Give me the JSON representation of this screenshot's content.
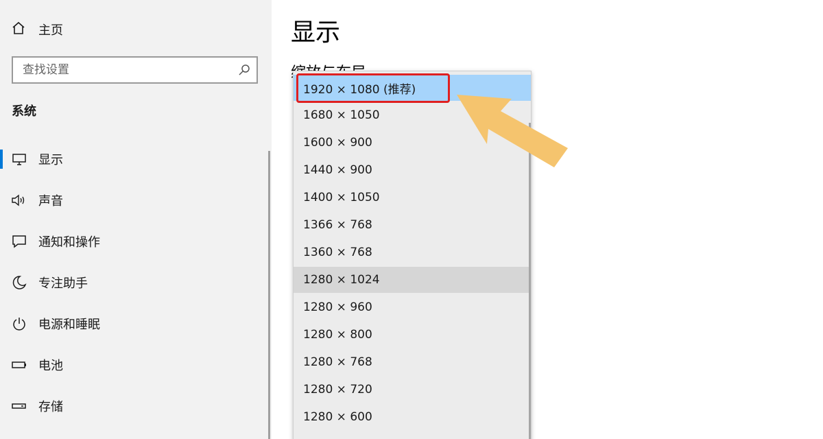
{
  "sidebar": {
    "home_label": "主页",
    "search_placeholder": "查找设置",
    "section_label": "系统",
    "items": [
      {
        "label": "显示",
        "icon": "monitor-icon"
      },
      {
        "label": "声音",
        "icon": "speaker-icon"
      },
      {
        "label": "通知和操作",
        "icon": "notification-icon"
      },
      {
        "label": "专注助手",
        "icon": "moon-icon"
      },
      {
        "label": "电源和睡眠",
        "icon": "power-icon"
      },
      {
        "label": "电池",
        "icon": "battery-icon"
      },
      {
        "label": "存储",
        "icon": "storage-icon"
      }
    ]
  },
  "main": {
    "title": "显示",
    "sub_heading": "缩放与布局"
  },
  "resolution_dropdown": {
    "options": [
      "1920 × 1080 (推荐)",
      "1680 × 1050",
      "1600 × 900",
      "1440 × 900",
      "1400 × 1050",
      "1366 × 768",
      "1360 × 768",
      "1280 × 1024",
      "1280 × 960",
      "1280 × 800",
      "1280 × 768",
      "1280 × 720",
      "1280 × 600"
    ],
    "selected_index": 0,
    "hovered_index": 7
  },
  "colors": {
    "accent": "#0078d7",
    "selected_bg": "#a6d4fb",
    "highlight_box": "#e02020",
    "arrow": "#f5c46e"
  }
}
